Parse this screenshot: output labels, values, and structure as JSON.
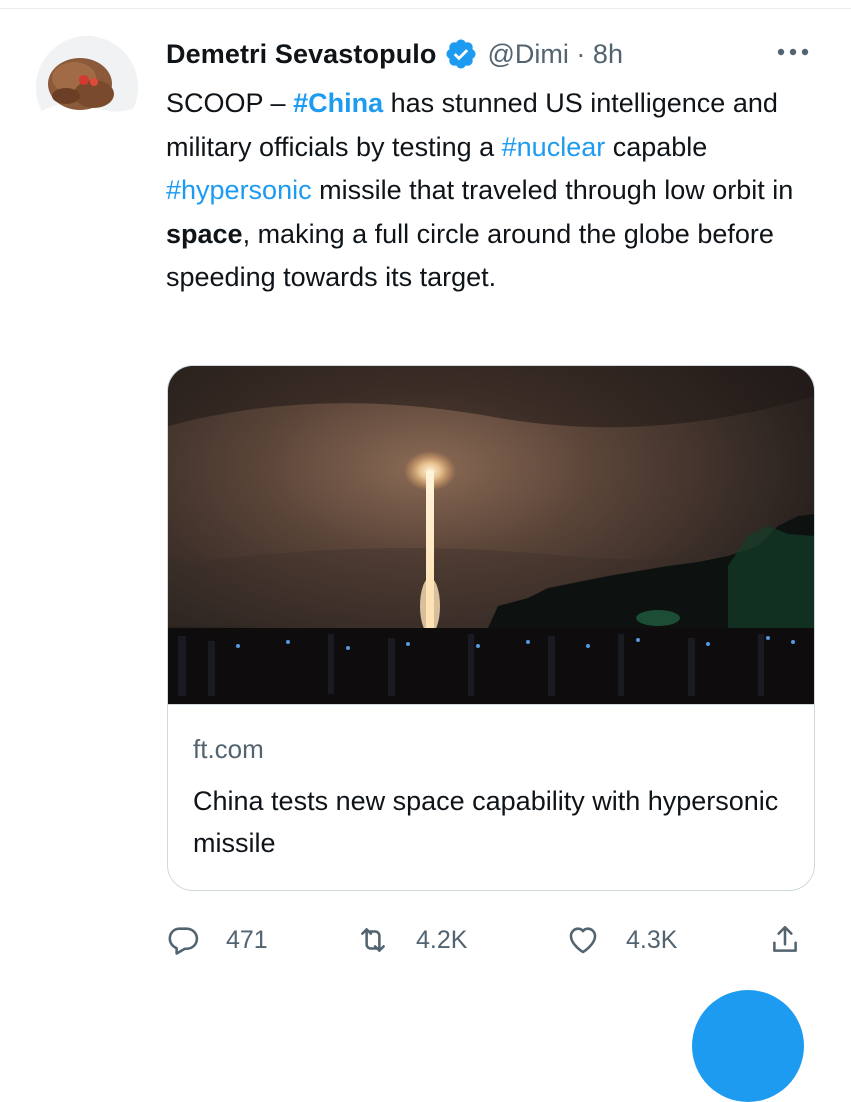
{
  "tweet": {
    "author_name": "Demetri Sevastopulo",
    "handle": "@Dimi",
    "separator": "·",
    "time": "8h",
    "text": {
      "p1": "SCOOP – ",
      "tag_china": "#China",
      "p2": " has stunned US intelligence and military officials by testing a ",
      "tag_nuclear": "#nuclear",
      "p3": " capable ",
      "tag_hypersonic": "#hypersonic",
      "p4": " missile that traveled through low orbit in ",
      "bold_space": "space",
      "p5": ", making a full circle around the globe before speeding towards its target."
    }
  },
  "card": {
    "domain": "ft.com",
    "title": "China tests new space capability with hypersonic missile"
  },
  "actions": {
    "replies": "471",
    "retweets": "4.2K",
    "likes": "4.3K"
  },
  "icons": {
    "verified": "verified-badge-icon",
    "more": "more-icon",
    "reply": "reply-icon",
    "retweet": "retweet-icon",
    "like": "heart-icon",
    "share": "share-icon"
  },
  "colors": {
    "accent": "#1d9bf0",
    "text": "#0f1419",
    "secondary": "#536471",
    "border": "#cfd9de"
  }
}
